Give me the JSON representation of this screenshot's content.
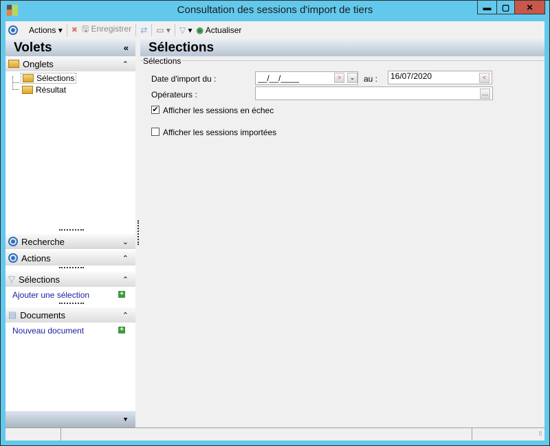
{
  "window": {
    "title": "Consultation des sessions d'import de tiers"
  },
  "toolbar": {
    "actions": "Actions",
    "save": "Enregistrer",
    "refresh": "Actualiser"
  },
  "sidebar": {
    "title": "Volets",
    "onglets": {
      "label": "Onglets",
      "items": [
        "Sélections",
        "Résultat"
      ]
    },
    "recherche": "Recherche",
    "actions": "Actions",
    "selections": {
      "label": "Sélections",
      "link": "Ajouter une sélection"
    },
    "documents": {
      "label": "Documents",
      "link": "Nouveau document"
    }
  },
  "main": {
    "title": "Sélections",
    "group": "Sélections",
    "date_label": "Date d'import du :",
    "date_from": "__/__/____",
    "au_label": "au :",
    "date_to": "16/07/2020",
    "operators_label": "Opérateurs :",
    "operators_value": "",
    "cb_failed": {
      "label": "Afficher les sessions en échec",
      "checked": true
    },
    "cb_imported": {
      "label": "Afficher les sessions importées",
      "checked": false
    }
  }
}
